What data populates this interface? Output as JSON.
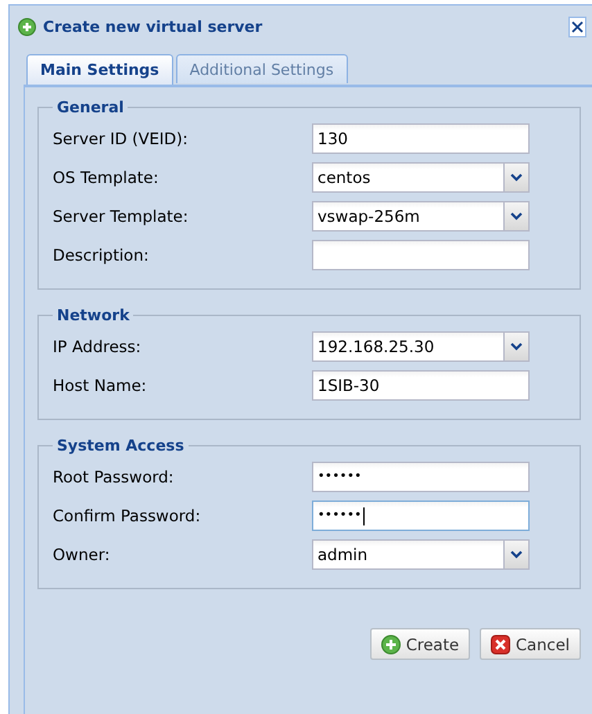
{
  "window": {
    "title": "Create new virtual server"
  },
  "tabs": [
    {
      "label": "Main Settings",
      "selected": true
    },
    {
      "label": "Additional Settings",
      "selected": false
    }
  ],
  "sections": [
    {
      "title": "General",
      "fields": [
        {
          "label": "Server ID (VEID):",
          "kind": "text",
          "value": "130",
          "focused": false
        },
        {
          "label": "OS Template:",
          "kind": "combo",
          "value": "centos",
          "focused": false
        },
        {
          "label": "Server Template:",
          "kind": "combo",
          "value": "vswap-256m",
          "focused": false
        },
        {
          "label": "Description:",
          "kind": "text",
          "focused": false
        }
      ]
    },
    {
      "title": "Network",
      "fields": [
        {
          "label": "IP Address:",
          "kind": "combo",
          "value": "192.168.25.30",
          "focused": false
        },
        {
          "label": "Host Name:",
          "kind": "text",
          "value": "1SIB-30",
          "focused": false
        }
      ]
    },
    {
      "title": "System Access",
      "fields": [
        {
          "label": "Root Password:",
          "kind": "password",
          "value": "••••••",
          "focused": false
        },
        {
          "label": "Confirm Password:",
          "kind": "password",
          "value": "••••••",
          "focused": true
        },
        {
          "label": "Owner:",
          "kind": "combo",
          "value": "admin",
          "focused": false
        }
      ]
    }
  ],
  "buttons": [
    {
      "label": "Create",
      "kind": "create"
    },
    {
      "label": "Cancel",
      "kind": "cancel"
    }
  ]
}
